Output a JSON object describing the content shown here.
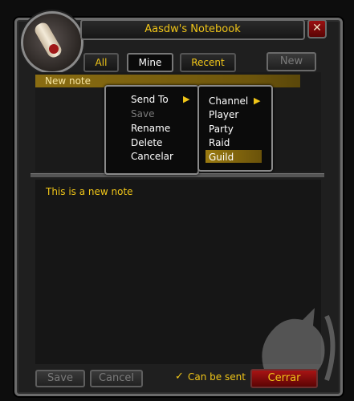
{
  "window": {
    "title": "Aasdw's Notebook",
    "close_glyph": "✕"
  },
  "tabs": [
    {
      "label": "All"
    },
    {
      "label": "Mine"
    },
    {
      "label": "Recent"
    }
  ],
  "toolbar": {
    "new_label": "New"
  },
  "notes": [
    {
      "title": "New note"
    }
  ],
  "context_menu": {
    "items": [
      "Send To",
      "Save",
      "Rename",
      "Delete",
      "Cancelar"
    ],
    "disabled": [
      "Save"
    ]
  },
  "submenu": {
    "items": [
      "Channel",
      "Player",
      "Party",
      "Raid",
      "Guild"
    ],
    "highlighted": "Guild"
  },
  "editor": {
    "content": "This is a new note"
  },
  "footer": {
    "save_label": "Save",
    "cancel_label": "Cancel",
    "can_be_sent_label": "Can be sent",
    "can_be_sent_checked": true,
    "close_label": "Cerrar"
  },
  "colors": {
    "gold": "#f0c518",
    "close_red": "#a81414",
    "highlight": "#9a7a10"
  },
  "icons": [
    "scroll-icon",
    "close-icon",
    "submenu-arrow-icon",
    "checkmark-icon",
    "wolf-emblem-icon"
  ]
}
